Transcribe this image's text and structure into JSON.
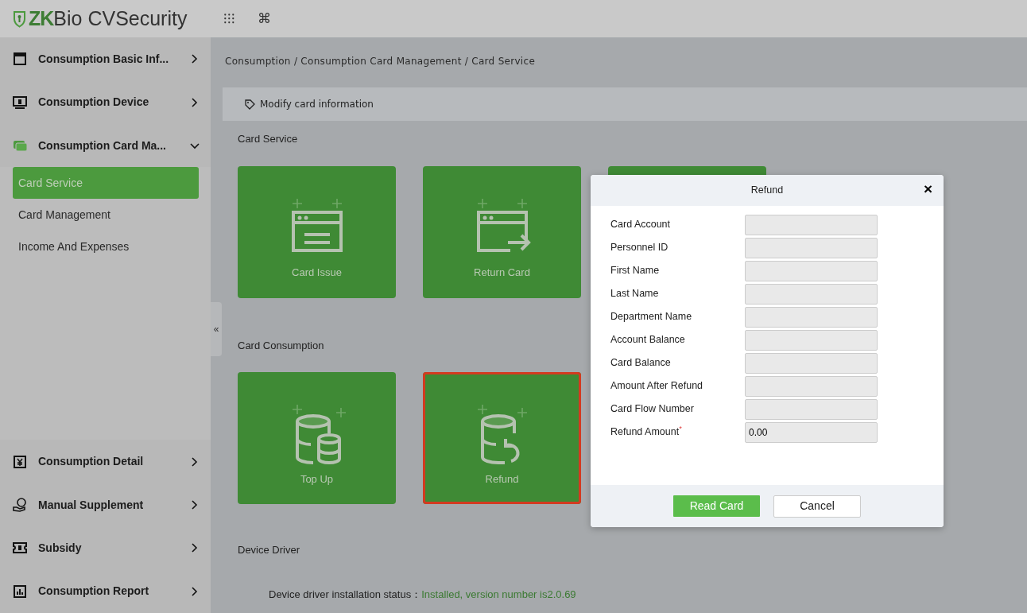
{
  "header": {
    "logo_brand": "ZK",
    "logo_rest": "Bio CVSecurity",
    "tools": [
      "⁝⁝⁝",
      "⌘"
    ]
  },
  "sidebar": {
    "groups": [
      {
        "label": "Consumption Basic Inf...",
        "expanded": false
      },
      {
        "label": "Consumption Device",
        "expanded": false
      },
      {
        "label": "Consumption Card Ma...",
        "expanded": true,
        "children": [
          {
            "label": "Card Service",
            "selected": true
          },
          {
            "label": "Card Management",
            "selected": false
          },
          {
            "label": "Income And Expenses",
            "selected": false
          }
        ]
      },
      {
        "label": "Consumption Detail",
        "expanded": false
      },
      {
        "label": "Manual Supplement",
        "expanded": false
      },
      {
        "label": "Subsidy",
        "expanded": false
      },
      {
        "label": "Consumption Report",
        "expanded": false
      }
    ],
    "collapse_handle": "«"
  },
  "breadcrumb": "Consumption / Consumption Card Management / Card Service",
  "toolbar": {
    "action": "Modify card information"
  },
  "sections": [
    {
      "title": "Card Service",
      "tiles": [
        {
          "label": "Card Issue",
          "highlighted": false
        },
        {
          "label": "Return Card",
          "highlighted": false
        },
        {
          "highlighted": false
        }
      ]
    },
    {
      "title": "Card Consumption",
      "tiles": [
        {
          "label": "Top Up",
          "highlighted": false
        },
        {
          "label": "Refund",
          "highlighted": true
        }
      ]
    },
    {
      "title": "Device Driver"
    }
  ],
  "driver_status": {
    "label": "Device driver installation status：",
    "value": "Installed, version number is2.0.69"
  },
  "dialog": {
    "title": "Refund",
    "close": "×",
    "fields": [
      {
        "label": "Card Account"
      },
      {
        "label": "Personnel ID"
      },
      {
        "label": "First Name"
      },
      {
        "label": "Last Name"
      },
      {
        "label": "Department Name"
      },
      {
        "label": "Account Balance"
      },
      {
        "label": "Card Balance"
      },
      {
        "label": "Amount After Refund"
      },
      {
        "label": "Card Flow Number"
      },
      {
        "label": "Refund Amount",
        "required_mark": "*",
        "value": "0.00"
      }
    ],
    "buttons": [
      {
        "label": "Read Card",
        "kind": "primary"
      },
      {
        "label": "Cancel",
        "kind": "secondary"
      }
    ]
  }
}
